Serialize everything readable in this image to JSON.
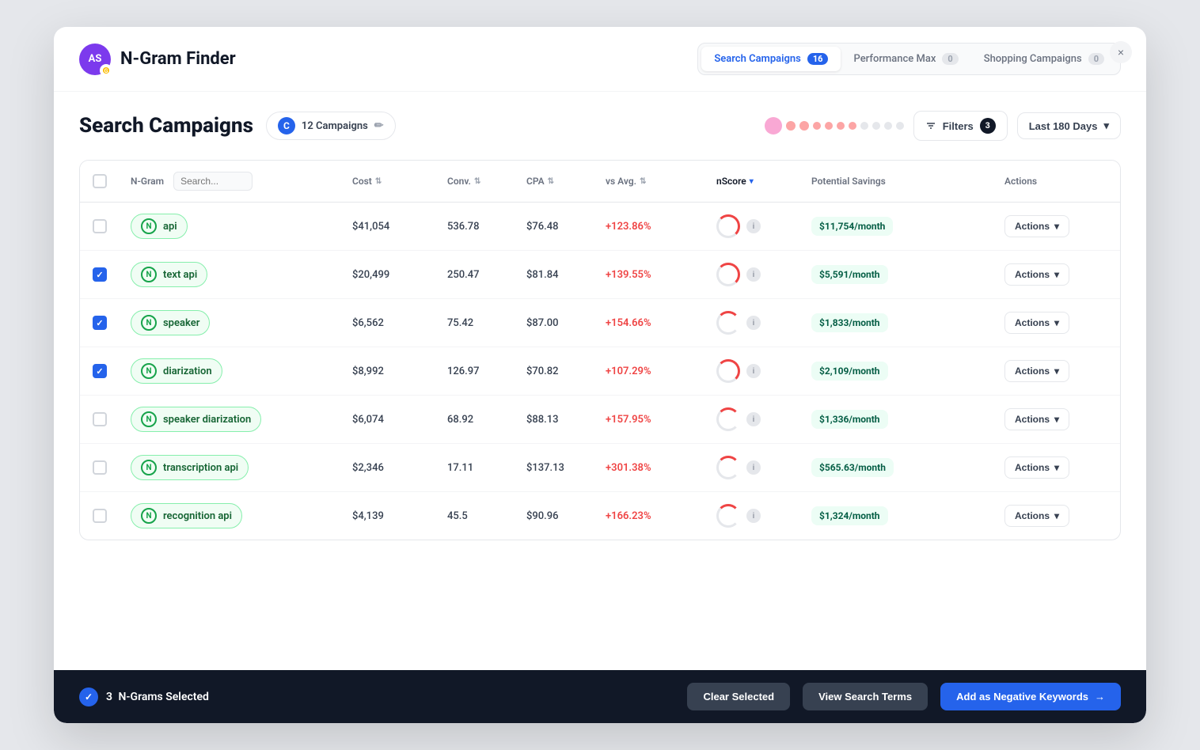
{
  "app": {
    "title": "N-Gram Finder",
    "avatar_initials": "AS",
    "close_label": "×"
  },
  "nav": {
    "tabs": [
      {
        "id": "search-campaigns",
        "label": "Search Campaigns",
        "count": "16",
        "active": true
      },
      {
        "id": "performance-max",
        "label": "Performance Max",
        "count": "0",
        "active": false
      },
      {
        "id": "shopping-campaigns",
        "label": "Shopping Campaigns",
        "count": "0",
        "active": false
      }
    ]
  },
  "section": {
    "title": "Search Campaigns",
    "campaigns_label": "12 Campaigns",
    "campaigns_icon": "C",
    "filters_label": "Filters",
    "filters_count": "3",
    "date_label": "Last 180 Days"
  },
  "dots": [
    {
      "color": "#f9a8d4",
      "size": "large"
    },
    {
      "color": "#fca5a5"
    },
    {
      "color": "#fca5a5"
    },
    {
      "color": "#fca5a5"
    },
    {
      "color": "#fca5a5"
    },
    {
      "color": "#fca5a5"
    },
    {
      "color": "#fca5a5"
    },
    {
      "color": "#fca5a5"
    },
    {
      "color": "#fca5a5"
    },
    {
      "color": "#fca5a5"
    },
    {
      "color": "#fca5a5"
    }
  ],
  "table": {
    "columns": [
      {
        "id": "checkbox",
        "label": ""
      },
      {
        "id": "ngram",
        "label": "N-Gram",
        "searchable": true
      },
      {
        "id": "cost",
        "label": "Cost",
        "sortable": true
      },
      {
        "id": "conv",
        "label": "Conv.",
        "sortable": true
      },
      {
        "id": "cpa",
        "label": "CPA",
        "sortable": true
      },
      {
        "id": "vsavg",
        "label": "vs Avg.",
        "sortable": true
      },
      {
        "id": "nscore",
        "label": "nScore",
        "sortable": true,
        "active": true
      },
      {
        "id": "potential_savings",
        "label": "Potential Savings"
      },
      {
        "id": "actions",
        "label": "Actions"
      }
    ],
    "rows": [
      {
        "id": "row-api",
        "checked": false,
        "ngram": "api",
        "cost": "$41,054",
        "conv": "536.78",
        "cpa": "$76.48",
        "vsavg": "+123.86%",
        "savings": "$11,754/month",
        "actions_label": "Actions"
      },
      {
        "id": "row-text-api",
        "checked": true,
        "ngram": "text api",
        "cost": "$20,499",
        "conv": "250.47",
        "cpa": "$81.84",
        "vsavg": "+139.55%",
        "savings": "$5,591/month",
        "actions_label": "Actions"
      },
      {
        "id": "row-speaker",
        "checked": true,
        "ngram": "speaker",
        "cost": "$6,562",
        "conv": "75.42",
        "cpa": "$87.00",
        "vsavg": "+154.66%",
        "savings": "$1,833/month",
        "actions_label": "Actions"
      },
      {
        "id": "row-diarization",
        "checked": true,
        "ngram": "diarization",
        "cost": "$8,992",
        "conv": "126.97",
        "cpa": "$70.82",
        "vsavg": "+107.29%",
        "savings": "$2,109/month",
        "actions_label": "Actions"
      },
      {
        "id": "row-speaker-diarization",
        "checked": false,
        "ngram": "speaker diarization",
        "cost": "$6,074",
        "conv": "68.92",
        "cpa": "$88.13",
        "vsavg": "+157.95%",
        "savings": "$1,336/month",
        "actions_label": "Actions"
      },
      {
        "id": "row-transcription-api",
        "checked": false,
        "ngram": "transcription api",
        "cost": "$2,346",
        "conv": "17.11",
        "cpa": "$137.13",
        "vsavg": "+301.38%",
        "savings": "$565.63/month",
        "actions_label": "Actions"
      },
      {
        "id": "row-recognition-api",
        "checked": false,
        "ngram": "recognition api",
        "cost": "$4,139",
        "conv": "45.5",
        "cpa": "$90.96",
        "vsavg": "+166.23%",
        "savings": "$1,324/month",
        "actions_label": "Actions"
      }
    ]
  },
  "bottom_bar": {
    "selected_count": "3",
    "selected_label": "N-Grams Selected",
    "clear_label": "Clear Selected",
    "view_label": "View Search Terms",
    "add_label": "Add as Negative Keywords",
    "check_icon": "✓",
    "arrow_icon": "→"
  }
}
